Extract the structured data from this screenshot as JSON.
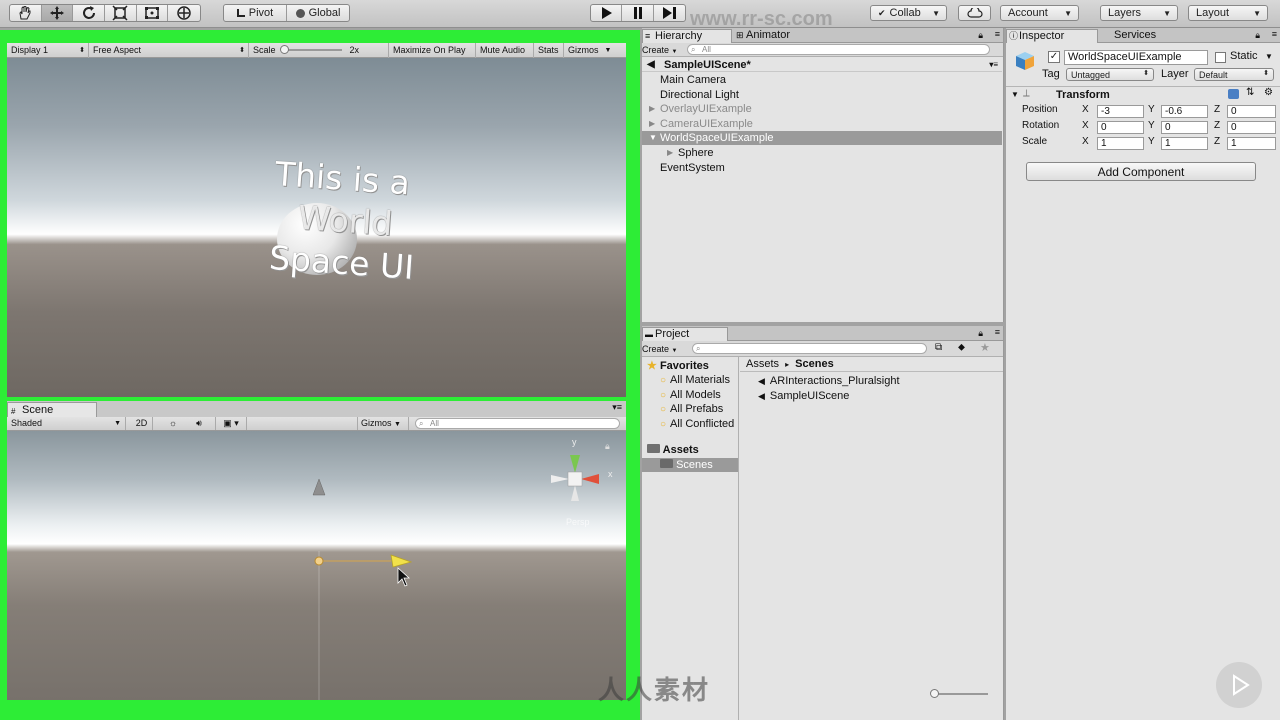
{
  "toolbar": {
    "pivot": "Pivot",
    "global": "Global",
    "collab": "Collab",
    "account": "Account",
    "layers": "Layers",
    "layout": "Layout",
    "watermark": "www.rr-sc.com"
  },
  "game": {
    "display": "Display 1",
    "aspect": "Free Aspect",
    "scale_label": "Scale",
    "scale_value": "2x",
    "maximize": "Maximize On Play",
    "mute": "Mute Audio",
    "stats": "Stats",
    "gizmos": "Gizmos",
    "world_text": [
      "This is a",
      "World",
      "Space UI"
    ]
  },
  "scene": {
    "tab": "Scene",
    "shading": "Shaded",
    "mode_2d": "2D",
    "gizmos": "Gizmos",
    "search_placeholder": "All",
    "persp": "Persp",
    "axis_x": "x",
    "axis_y": "y"
  },
  "hierarchy": {
    "tab": "Hierarchy",
    "tab2": "Animator",
    "create": "Create",
    "search_placeholder": "All",
    "scene_name": "SampleUIScene*",
    "items": [
      {
        "label": "Main Camera",
        "indent": 1,
        "dim": false,
        "selected": false,
        "arrow": false
      },
      {
        "label": "Directional Light",
        "indent": 1,
        "dim": false,
        "selected": false,
        "arrow": false
      },
      {
        "label": "OverlayUIExample",
        "indent": 1,
        "dim": true,
        "selected": false,
        "arrow": true
      },
      {
        "label": "CameraUIExample",
        "indent": 1,
        "dim": true,
        "selected": false,
        "arrow": true
      },
      {
        "label": "WorldSpaceUIExample",
        "indent": 1,
        "dim": false,
        "selected": true,
        "arrow": true
      },
      {
        "label": "Sphere",
        "indent": 2,
        "dim": false,
        "selected": false,
        "arrow": true
      },
      {
        "label": "EventSystem",
        "indent": 1,
        "dim": false,
        "selected": false,
        "arrow": false
      }
    ]
  },
  "project": {
    "tab": "Project",
    "create": "Create",
    "favorites": "Favorites",
    "favorite_items": [
      "All Materials",
      "All Models",
      "All Prefabs",
      "All Conflicted"
    ],
    "assets": "Assets",
    "scenes_folder": "Scenes",
    "breadcrumb_root": "Assets",
    "breadcrumb_sep": "▸",
    "breadcrumb_current": "Scenes",
    "files": [
      "ARInteractions_Pluralsight",
      "SampleUIScene"
    ]
  },
  "inspector": {
    "tab": "Inspector",
    "tab2": "Services",
    "object_name": "WorldSpaceUIExample",
    "static_label": "Static",
    "tag_label": "Tag",
    "tag_value": "Untagged",
    "layer_label": "Layer",
    "layer_value": "Default",
    "component": "Transform",
    "rows": [
      {
        "label": "Position",
        "x": "-3",
        "y": "-0.6",
        "z": "0"
      },
      {
        "label": "Rotation",
        "x": "0",
        "y": "0",
        "z": "0"
      },
      {
        "label": "Scale",
        "x": "1",
        "y": "1",
        "z": "1"
      }
    ],
    "axis_x": "X",
    "axis_y": "Y",
    "axis_z": "Z",
    "add_component": "Add Component"
  },
  "colors": {
    "highlight_frame": "#2ded36",
    "selection": "#9a9a9a",
    "gizmo_y": "#7ac74f",
    "gizmo_x": "#e0503a"
  },
  "watermark_logo": "人人素材"
}
